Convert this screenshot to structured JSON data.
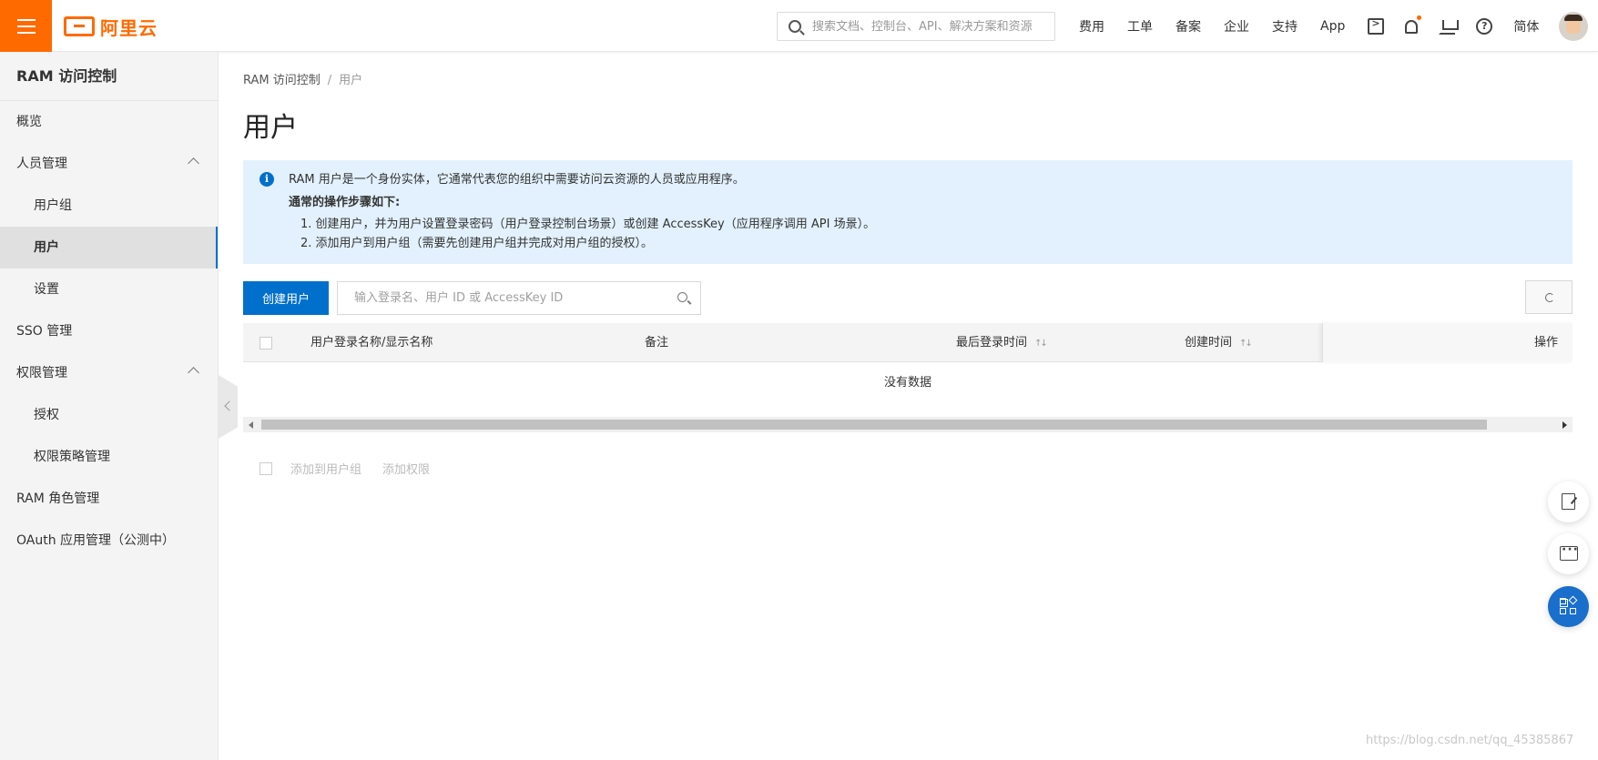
{
  "header": {
    "brand": "阿里云",
    "search_placeholder": "搜索文档、控制台、API、解决方案和资源",
    "nav": [
      "费用",
      "工单",
      "备案",
      "企业",
      "支持",
      "App"
    ],
    "language": "简体"
  },
  "sidebar": {
    "title": "RAM 访问控制",
    "items": [
      {
        "label": "概览"
      },
      {
        "label": "人员管理"
      },
      {
        "label": "用户组"
      },
      {
        "label": "用户"
      },
      {
        "label": "设置"
      },
      {
        "label": "SSO 管理"
      },
      {
        "label": "权限管理"
      },
      {
        "label": "授权"
      },
      {
        "label": "权限策略管理"
      },
      {
        "label": "RAM 角色管理"
      },
      {
        "label": "OAuth 应用管理（公测中）"
      }
    ]
  },
  "breadcrumb": {
    "root": "RAM 访问控制",
    "separator": "/",
    "current": "用户"
  },
  "page_title": "用户",
  "notice": {
    "line1": "RAM 用户是一个身份实体，它通常代表您的组织中需要访问云资源的人员或应用程序。",
    "line2": "通常的操作步骤如下:",
    "line3": "1. 创建用户，并为用户设置登录密码（用户登录控制台场景）或创建 AccessKey（应用程序调用 API 场景）。",
    "line4": "2. 添加用户到用户组（需要先创建用户组并完成对用户组的授权）。"
  },
  "toolbar": {
    "create_label": "创建用户",
    "search_placeholder": "输入登录名、用户 ID 或 AccessKey ID"
  },
  "table": {
    "columns": [
      "用户登录名称/显示名称",
      "备注",
      "最后登录时间",
      "创建时间",
      "操作"
    ],
    "empty_text": "没有数据"
  },
  "footer_actions": {
    "add_to_group": "添加到用户组",
    "add_permission": "添加权限"
  },
  "watermark": "https://blog.csdn.net/qq_45385867",
  "colors": {
    "brand": "#ff6a00",
    "primary": "#0070cc",
    "notice_bg": "#e2f1fd"
  }
}
